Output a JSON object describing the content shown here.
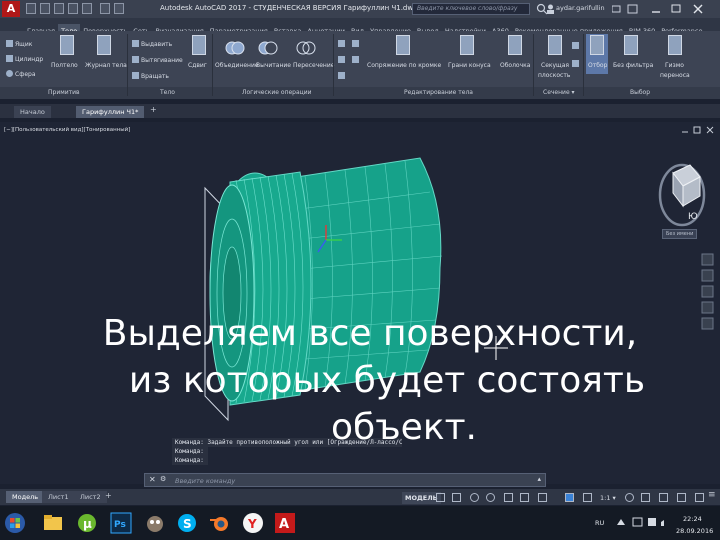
{
  "title_bar": {
    "app_logo": "A",
    "window_title": "Autodesk AutoCAD 2017 - СТУДЕНЧЕСКАЯ ВЕРСИЯ   Гарифуллин Ч1.dwg",
    "search_placeholder": "Введите ключевое слово/фразу",
    "user": "aydar.garifullin"
  },
  "ribbon_tabs": [
    "Главная",
    "Тело",
    "Поверхность",
    "Сеть",
    "Визуализация",
    "Параметризация",
    "Вставка",
    "Аннотации",
    "Вид",
    "Управление",
    "Вывод",
    "Надстройки",
    "A360",
    "Рекомендованные приложения",
    "BIM 360",
    "Performance"
  ],
  "active_tab": "Тело",
  "ribbon": {
    "primitives": {
      "box": "Ящик",
      "cylinder": "Цилиндр",
      "sphere": "Сфера",
      "polysolid": "Полтело",
      "history": "Журнал тела",
      "group": "Примитив"
    },
    "solid": {
      "extrude": "Выдавить",
      "loft": "Вытягивание",
      "revolve": "Вращать",
      "sweep": "Сдвиг",
      "group": "Тело"
    },
    "boolean": {
      "union": "Объединение",
      "subtract": "Вычитание",
      "intersect": "Пересечение",
      "group": "Логические операции"
    },
    "edit": {
      "fillet": "Сопряжение по кромке",
      "taper": "Грани конуса",
      "shell": "Оболочка",
      "group": "Редактирование тела"
    },
    "section": {
      "plane_line1": "Секущая",
      "plane_line2": "плоскость",
      "group": "Сечение ▾"
    },
    "selection": {
      "culling": "Отбор",
      "filter": "Без фильтра",
      "gizmo_line1": "Гизмо",
      "gizmo_line2": "переноса",
      "group": "Выбор"
    }
  },
  "file_tabs": [
    "Начало",
    "Гарифуллин Ч1*"
  ],
  "viewport": {
    "caption": "[−][Пользовательский вид][Тонированный]",
    "viewcube_face": "Ю",
    "viewcube_label": "Без имени"
  },
  "command": {
    "history": [
      "Команда: Задайте противоположный угол или [Ограждение/Л-лассо/С-лассо]:",
      "Команда:",
      "Команда:"
    ],
    "input_placeholder": "Введите команду"
  },
  "layout_tabs": [
    "Модель",
    "Лист1",
    "Лист2"
  ],
  "status_bar": {
    "model": "МОДЕЛЬ",
    "scale": "1:1 ▾"
  },
  "taskbar": {
    "language": "RU",
    "time": "22:24",
    "date": "28.09.2016"
  },
  "overlay_caption": [
    "Выделяем все поверхности,",
    "из которых будет состоять",
    "объект."
  ],
  "colors": {
    "model_fill": "#18a98e",
    "model_wire": "#5fd6c4",
    "caption_text": "#ffffff",
    "viewport_bg": "#1f2535",
    "autocad_red": "#b01818"
  }
}
